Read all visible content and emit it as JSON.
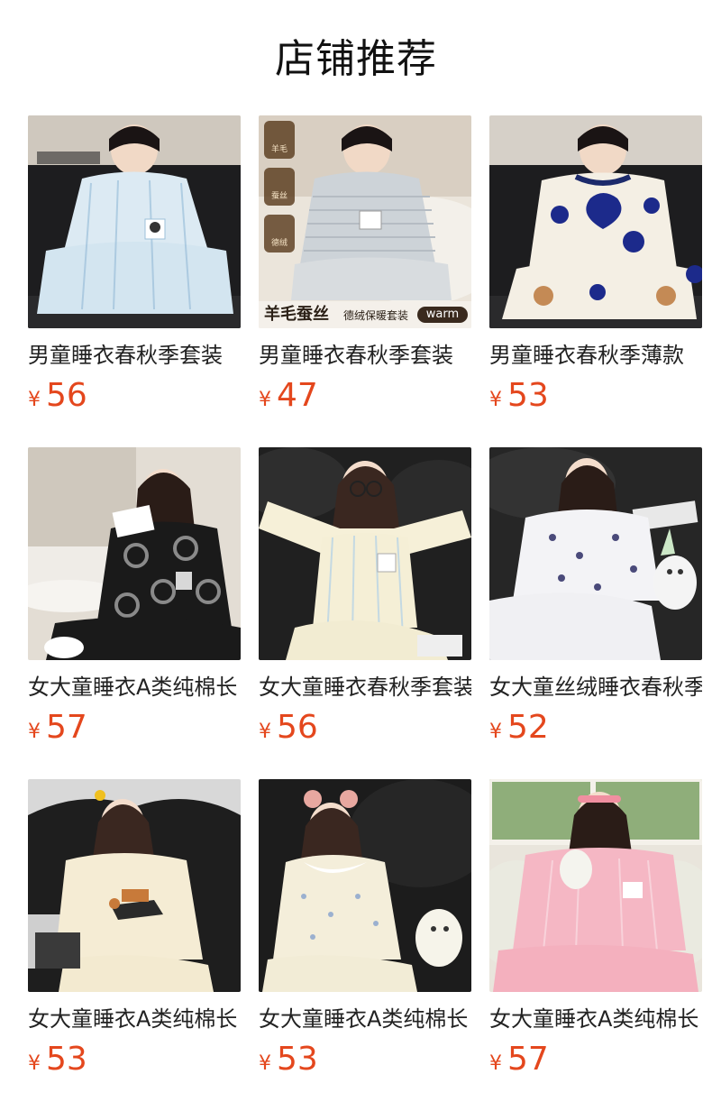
{
  "page": {
    "title": "店铺推荐"
  },
  "products": [
    {
      "name": "男童睡衣春秋季套装",
      "currency": "¥",
      "price": "56"
    },
    {
      "name": "男童睡衣春秋季套装",
      "currency": "¥",
      "price": "47",
      "promo": {
        "text": "羊毛蚕丝",
        "sub": "德绒保暖套装",
        "pill": "warm",
        "badges": [
          "羊毛",
          "蚕丝",
          "德绒"
        ]
      }
    },
    {
      "name": "男童睡衣春秋季薄款",
      "currency": "¥",
      "price": "53"
    },
    {
      "name": "女大童睡衣A类纯棉长",
      "currency": "¥",
      "price": "57"
    },
    {
      "name": "女大童睡衣春秋季套装",
      "currency": "¥",
      "price": "56"
    },
    {
      "name": "女大童丝绒睡衣春秋季",
      "currency": "¥",
      "price": "52"
    },
    {
      "name": "女大童睡衣A类纯棉长",
      "currency": "¥",
      "price": "53"
    },
    {
      "name": "女大童睡衣A类纯棉长",
      "currency": "¥",
      "price": "53"
    },
    {
      "name": "女大童睡衣A类纯棉长",
      "currency": "¥",
      "price": "57"
    }
  ],
  "colors": {
    "price": "#e4471d",
    "title": "#111111"
  }
}
